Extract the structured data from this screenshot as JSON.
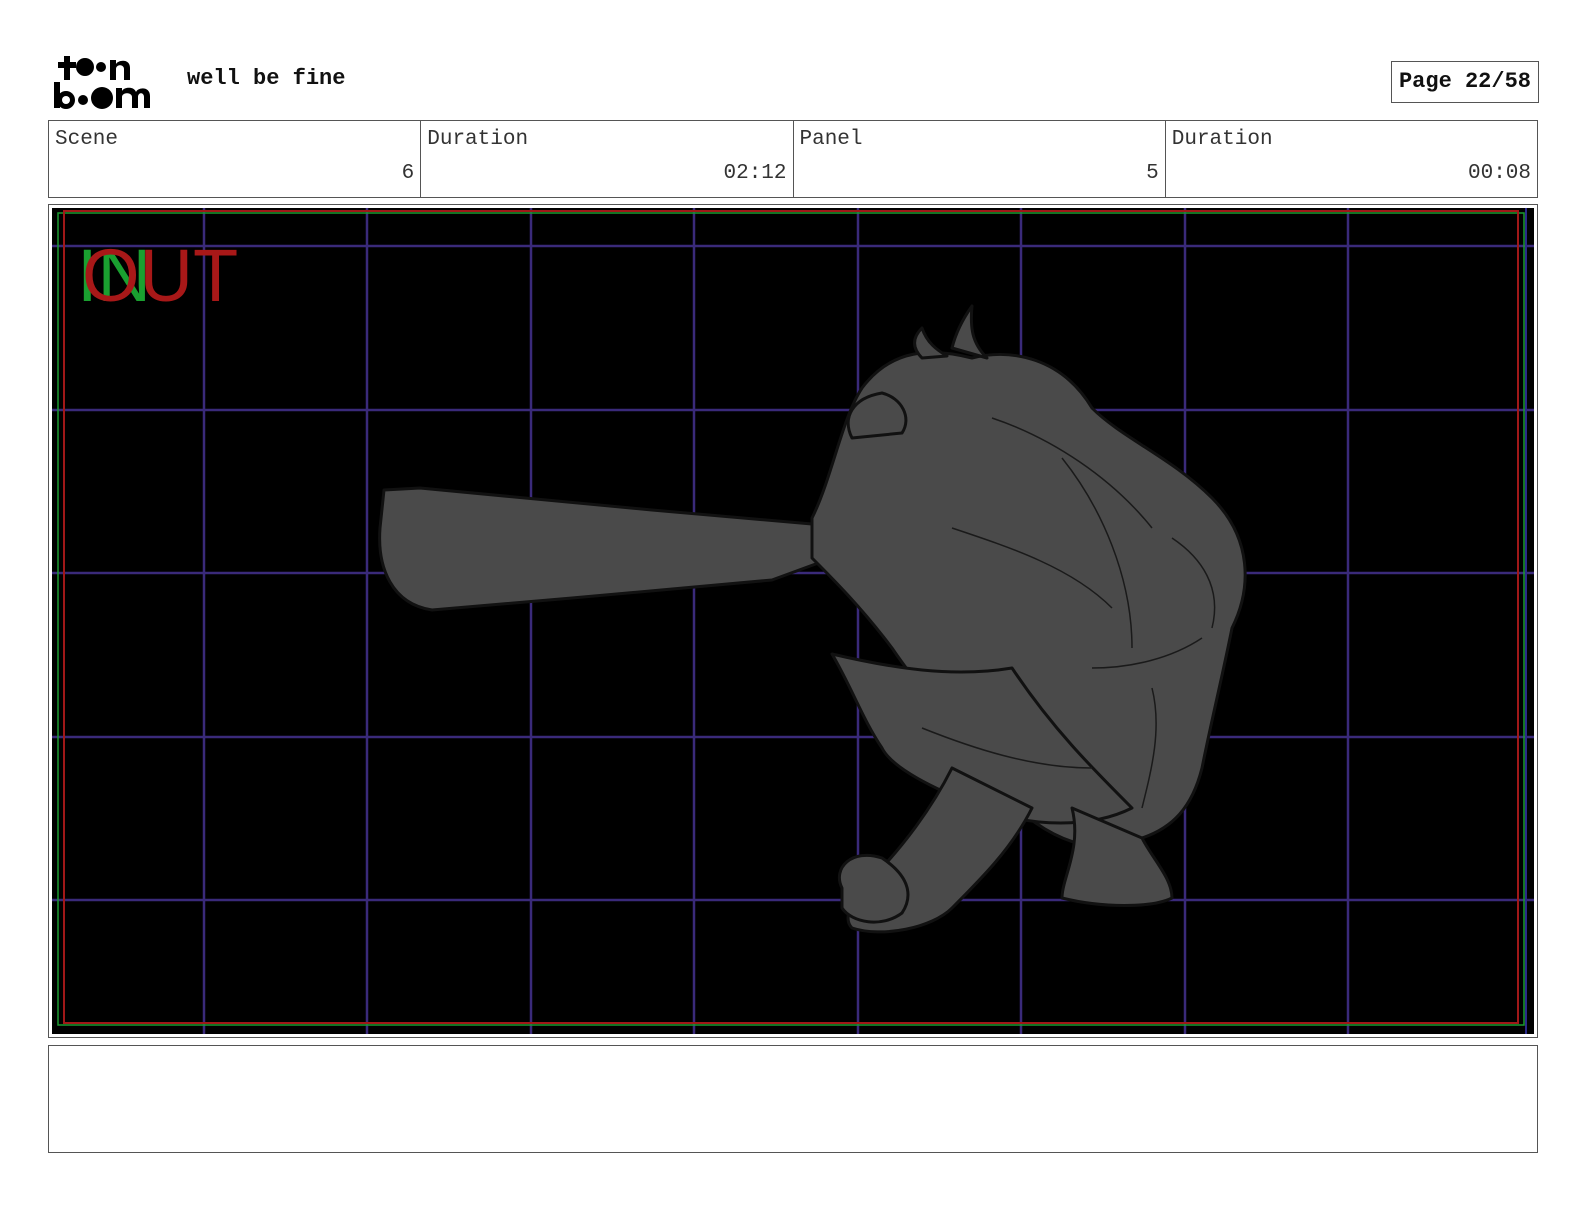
{
  "header": {
    "project_title": "well be fine",
    "page_label": "Page 22/58"
  },
  "info": [
    {
      "label": "Scene",
      "value": "6"
    },
    {
      "label": "Duration",
      "value": "02:12"
    },
    {
      "label": "Panel",
      "value": "5"
    },
    {
      "label": "Duration",
      "value": "00:08"
    }
  ],
  "panel": {
    "overlay_in": "IN",
    "overlay_out": "OUT"
  },
  "colors": {
    "grid": "#3a2a7a",
    "safe_red": "#a01818",
    "safe_green": "#1a9a30",
    "figure": "#4a4a4a"
  },
  "notes": ""
}
